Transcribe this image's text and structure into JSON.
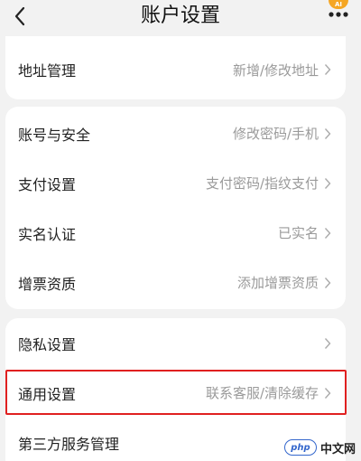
{
  "header": {
    "title": "账户设置",
    "back_icon": "chevron-left-icon",
    "more_icon": "more-dots-icon",
    "badge_text": "AI"
  },
  "groups": [
    {
      "rows": [
        {
          "label": "地址管理",
          "value": "新增/修改地址"
        }
      ]
    },
    {
      "rows": [
        {
          "label": "账号与安全",
          "value": "修改密码/手机"
        },
        {
          "label": "支付设置",
          "value": "支付密码/指纹支付"
        },
        {
          "label": "实名认证",
          "value": "已实名"
        },
        {
          "label": "增票资质",
          "value": "添加增票资质"
        }
      ]
    },
    {
      "rows": [
        {
          "label": "隐私设置",
          "value": ""
        },
        {
          "label": "通用设置",
          "value": "联系客服/清除缓存",
          "highlighted": true
        },
        {
          "label": "第三方服务管理",
          "value": ""
        }
      ]
    }
  ],
  "watermark": {
    "logo_text": "php",
    "text": "中文网"
  },
  "colors": {
    "background": "#f2f2f2",
    "card": "#ffffff",
    "secondary_text": "#9a9a9a",
    "highlight_border": "#e02020"
  }
}
